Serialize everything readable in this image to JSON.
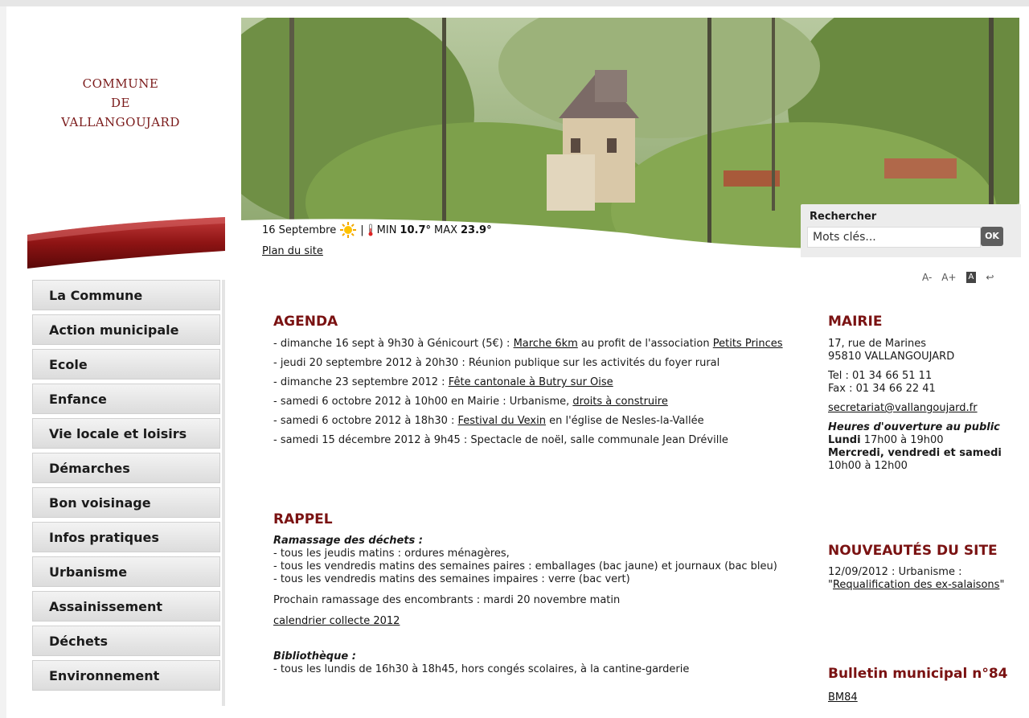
{
  "logo": {
    "line1": "COMMUNE",
    "line2": "DE",
    "line3": "VALLANGOUJARD"
  },
  "nav": [
    "La Commune",
    "Action municipale",
    "Ecole",
    "Enfance",
    "Vie locale et loisirs",
    "Démarches",
    "Bon voisinage",
    "Infos pratiques",
    "Urbanisme",
    "Assainissement",
    "Déchets",
    "Environnement"
  ],
  "weather": {
    "date": "16 Septembre",
    "sep": "|",
    "min_label": "MIN",
    "min": "10.7°",
    "max_label": "MAX",
    "max": "23.9°"
  },
  "sitemap_label": "Plan du site",
  "search": {
    "label": "Rechercher",
    "placeholder": "Mots clés...",
    "button": "OK"
  },
  "tools": {
    "smaller": "A-",
    "bigger": "A+",
    "normal": "A",
    "back": "↩"
  },
  "agenda": {
    "title": "AGENDA",
    "items": [
      {
        "pre": "- dimanche 16 sept à 9h30 à Génicourt (5€) : ",
        "link1": "Marche 6km",
        "mid": " au profit de l'association ",
        "link2": "Petits Princes"
      },
      {
        "pre": "- jeudi 20 septembre 2012 à 20h30 : Réunion publique sur les activités du foyer rural"
      },
      {
        "pre": "- dimanche 23 septembre 2012 : ",
        "link1": "Fête cantonale à Butry sur Oise"
      },
      {
        "pre": "- samedi 6 octobre 2012 à 10h00 en Mairie : Urbanisme, ",
        "link1": "droits à construire"
      },
      {
        "pre": "- samedi 6 octobre 2012 à 18h30 : ",
        "link1": "Festival du Vexin",
        "mid": " en l'église de Nesles-la-Vallée"
      },
      {
        "pre": "- samedi 15 décembre 2012 à 9h45 : Spectacle de noël, salle communale Jean Dréville"
      }
    ]
  },
  "rappel": {
    "title": "RAPPEL",
    "dechets_title": "Ramassage des déchets :",
    "dechets": [
      "- tous les jeudis matins : ordures ménagères,",
      "- tous les vendredis matins des semaines paires : emballages (bac jaune) et journaux (bac bleu)",
      "- tous les vendredis matins des semaines impaires : verre (bac vert)"
    ],
    "encombrants": "Prochain ramassage des encombrants : mardi 20 novembre matin",
    "calendrier_link": "calendrier collecte 2012",
    "biblio_title": "Bibliothèque :",
    "biblio": "- tous les lundis de 16h30 à 18h45, hors congés scolaires, à la cantine-garderie"
  },
  "mairie": {
    "title": "MAIRIE",
    "addr1": "17, rue de Marines",
    "addr2": "95810 VALLANGOUJARD",
    "tel": "Tel : 01 34 66 51 11",
    "fax": "Fax : 01 34 66 22 41",
    "email": "secretariat@vallangoujard.fr",
    "hours_title": "Heures d'ouverture au public",
    "day1": "Lundi",
    "hours1": " 17h00 à 19h00",
    "day2": "Mercredi, vendredi et samedi",
    "hours2": "10h00 à 12h00"
  },
  "nouveautes": {
    "title": "NOUVEAUTÉS DU SITE",
    "line1": "12/09/2012 : Urbanisme :",
    "quote_open": "\"",
    "link": "Requalification des ex-salaisons",
    "quote_close": "\""
  },
  "bulletin": {
    "title": "Bulletin municipal n°84",
    "link": "BM84"
  },
  "colors": {
    "accent": "#7a1212",
    "nav_bg": "#e6e6e6",
    "search_bg": "#ececec"
  }
}
